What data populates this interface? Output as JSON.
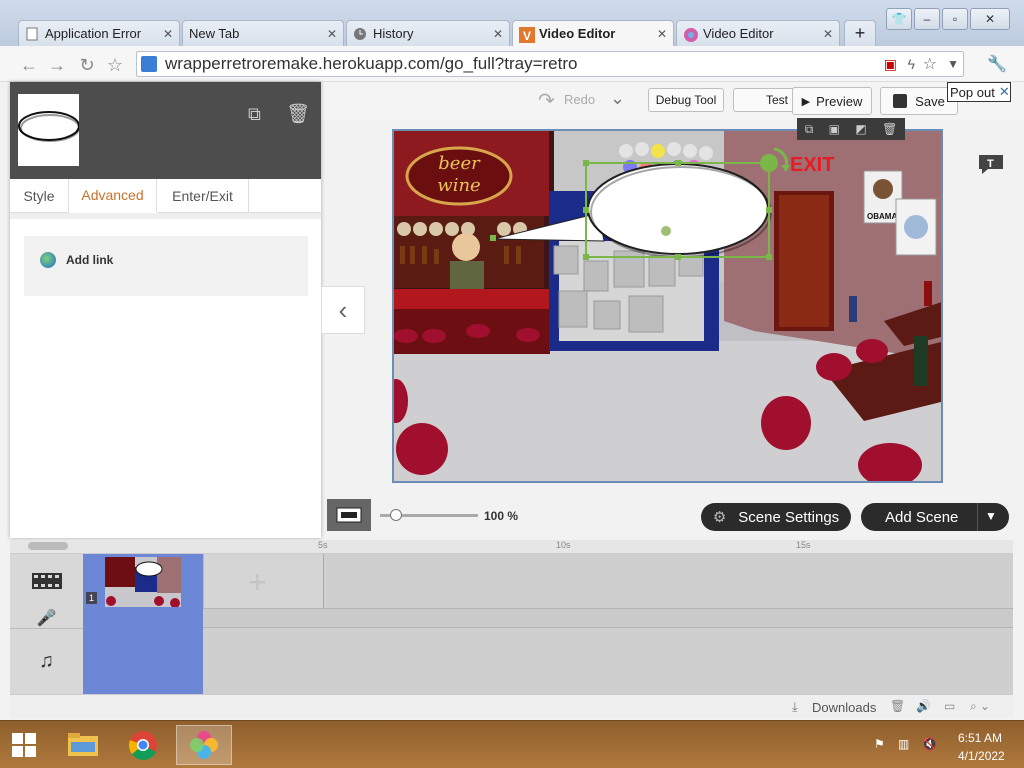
{
  "browser": {
    "tabs": [
      {
        "title": "Application Error",
        "active": false
      },
      {
        "title": "New Tab",
        "active": false
      },
      {
        "title": "History",
        "active": false
      },
      {
        "title": "Video Editor",
        "active": true
      },
      {
        "title": "Video Editor",
        "active": false
      }
    ],
    "new_tab_label": "+",
    "url": "wrapperretroremake.herokuapp.com/go_full?tray=retro"
  },
  "editor": {
    "redo_label": "Redo",
    "debug_label": "Debug Tool",
    "test_label": "Test",
    "preview_label": "Preview",
    "save_label": "Save",
    "popout_label": "Pop out",
    "zoom_value": "100 %",
    "scene_settings_label": "Scene Settings",
    "add_scene_label": "Add Scene",
    "sign_lines": [
      "beer",
      "wine"
    ],
    "exit_sign": "EXIT",
    "poster_label": "OBAMA"
  },
  "panel": {
    "tabs": [
      {
        "label": "Style",
        "active": false
      },
      {
        "label": "Advanced",
        "active": true
      },
      {
        "label": "Enter/Exit",
        "active": false
      }
    ],
    "add_link_label": "Add link"
  },
  "timeline": {
    "ruler_marks": [
      "5s",
      "10s",
      "15s"
    ],
    "scene_number": "1"
  },
  "status": {
    "downloads_label": "Downloads"
  },
  "taskbar": {
    "time": "6:51 AM",
    "date": "4/1/2022"
  },
  "colors": {
    "accent_tab": "#c8722c",
    "selection": "#7ab648",
    "scene_selected": "#6b87d6"
  }
}
